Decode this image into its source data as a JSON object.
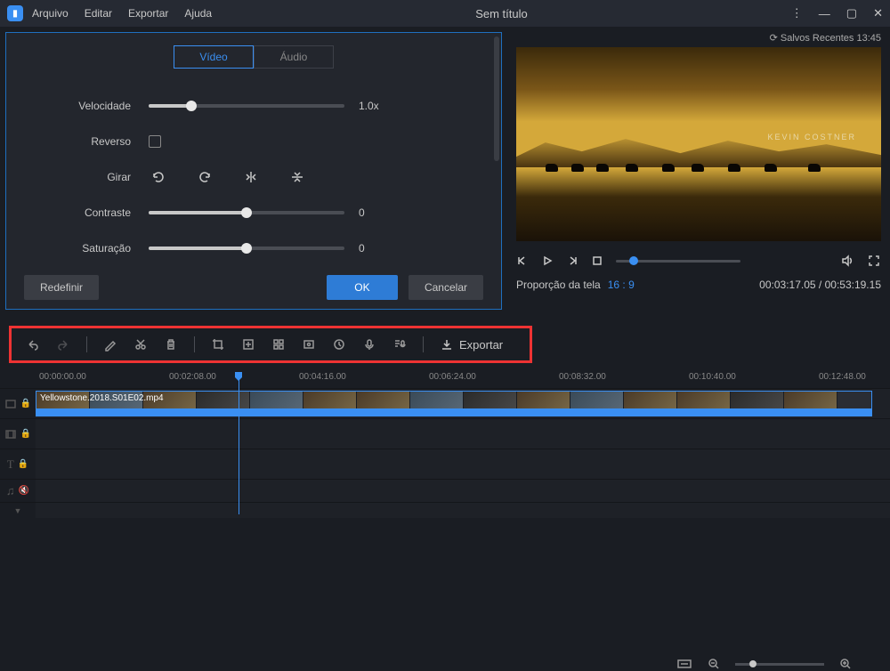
{
  "titlebar": {
    "menu": [
      "Arquivo",
      "Editar",
      "Exportar",
      "Ajuda"
    ],
    "title": "Sem título"
  },
  "saved_recent": "Salvos Recentes 13:45",
  "props": {
    "tabs": {
      "video": "Vídeo",
      "audio": "Áudio"
    },
    "speed": {
      "label": "Velocidade",
      "value": "1.0x"
    },
    "reverse": {
      "label": "Reverso"
    },
    "rotate": {
      "label": "Girar"
    },
    "contrast": {
      "label": "Contraste",
      "value": "0"
    },
    "saturation": {
      "label": "Saturação",
      "value": "0"
    },
    "reset": "Redefinir",
    "ok": "OK",
    "cancel": "Cancelar"
  },
  "preview": {
    "credit": "KEVIN COSTNER",
    "ratio_label": "Proporção da tela",
    "ratio": "16 : 9",
    "current_time": "00:03:17.05",
    "total_time": "00:53:19.15"
  },
  "toolbar": {
    "export_label": "Exportar"
  },
  "ruler_marks": [
    "00:00:00.00",
    "00:02:08.00",
    "00:04:16.00",
    "00:06:24.00",
    "00:08:32.00",
    "00:10:40.00",
    "00:12:48.00"
  ],
  "clip": {
    "name": "Yellowstone.2018.S01E02.mp4"
  }
}
